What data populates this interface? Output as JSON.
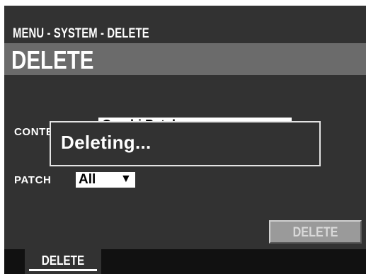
{
  "header": {
    "breadcrumb": "MENU - SYSTEM - DELETE",
    "title": "DELETE"
  },
  "form": {
    "content_label": "CONTENT",
    "content_value": "Combi Patch",
    "patch_label": "PATCH",
    "patch_value": "All",
    "patch_arrow": "▼"
  },
  "dialog": {
    "message": "Deleting..."
  },
  "actions": {
    "delete_label": "DELETE"
  },
  "tabs": [
    {
      "label": "DELETE",
      "active": true
    }
  ],
  "colors": {
    "screen_bg": "#323232",
    "title_bar_bg": "#6b6b6b",
    "button_bg": "#9a9a9a",
    "text": "#ffffff"
  }
}
